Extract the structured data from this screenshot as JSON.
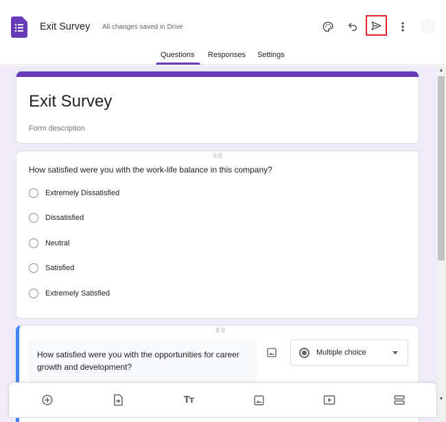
{
  "app": {
    "form_name": "Exit Survey",
    "save_status": "All changes saved in Drive"
  },
  "header_icons": [
    "forms-icon",
    "palette-icon",
    "undo-icon",
    "send-icon",
    "more-vert-icon",
    "avatar"
  ],
  "tabs": [
    {
      "label": "Questions",
      "active": true
    },
    {
      "label": "Responses",
      "active": false
    },
    {
      "label": "Settings",
      "active": false
    }
  ],
  "form": {
    "title": "Exit Survey",
    "description_placeholder": "Form description"
  },
  "questions": [
    {
      "text": "How satisfied were you with the work-life balance in this company?",
      "options": [
        "Extremely Dissatisfied",
        "Dissatisfied",
        "Neutral",
        "Satisfied",
        "Extremely Satisfied"
      ]
    },
    {
      "text": "How satisfied were you with the opportunities for career growth and development?",
      "type": "Multiple choice"
    }
  ],
  "toolbar_icons": [
    "add-question-icon",
    "import-questions-icon",
    "add-title-icon",
    "add-image-icon",
    "add-video-icon",
    "add-section-icon"
  ],
  "colors": {
    "accent": "#673ab7",
    "background": "#f0ebf8",
    "active_question_border": "#4285f4",
    "highlight_box": "#e2202a"
  }
}
